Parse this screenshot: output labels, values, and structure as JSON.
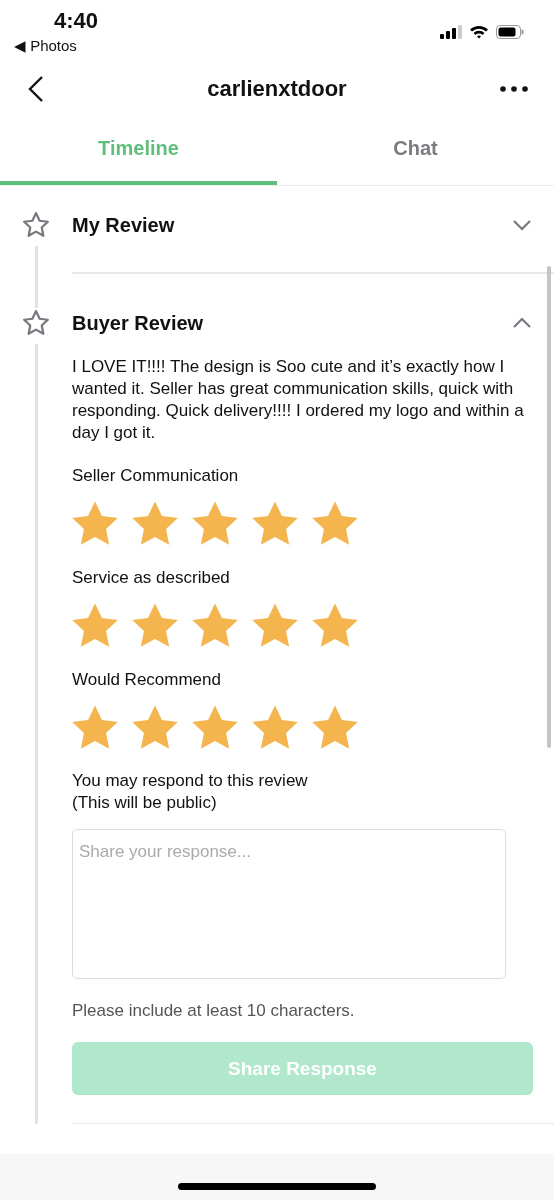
{
  "status_bar": {
    "time": "4:40",
    "back_app": "◀ Photos"
  },
  "nav": {
    "title": "carlienxtdoor"
  },
  "tabs": [
    {
      "label": "Timeline",
      "selected": true
    },
    {
      "label": "Chat",
      "selected": false
    }
  ],
  "sections": [
    {
      "title": "My Review",
      "expanded": false
    },
    {
      "title": "Buyer Review",
      "expanded": true,
      "review": "I LOVE IT!!!! The design is Soo cute and it’s exactly how I wanted it. Seller has great communication skills, quick with responding. Quick delivery!!!! I ordered my logo and within a day I got it.",
      "ratings": [
        {
          "label": "Seller Communication",
          "stars": 5
        },
        {
          "label": "Service as described",
          "stars": 5
        },
        {
          "label": "Would Recommend",
          "stars": 5
        }
      ],
      "respond_prompt": "You may respond to this review",
      "respond_note": "(This will be public)",
      "response": {
        "placeholder": "Share your response..."
      },
      "hint": "Please include at least 10 characters.",
      "button": {
        "label": "Share Response",
        "disabled": true
      }
    }
  ]
}
